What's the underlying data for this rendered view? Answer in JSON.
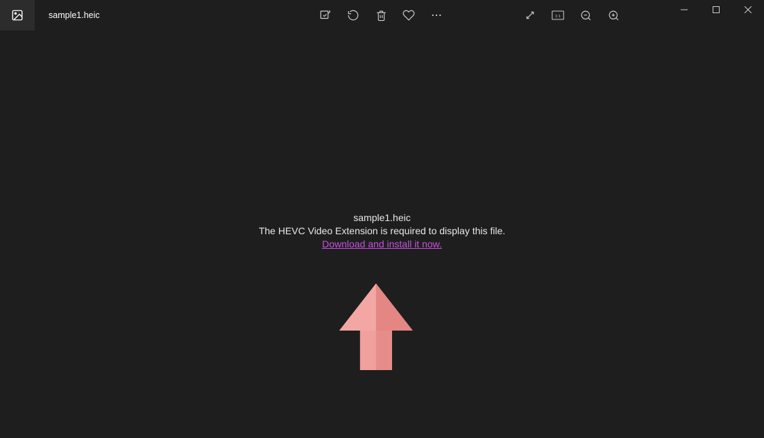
{
  "titlebar": {
    "filename": "sample1.heic"
  },
  "toolbar": {
    "center_icons": {
      "edit": "edit-image-icon",
      "rotate": "rotate-icon",
      "delete": "delete-icon",
      "favorite": "favorite-icon",
      "more": "more-icon"
    },
    "right_icons": {
      "fullscreen": "fullscreen-icon",
      "actual_size": "actual-size-icon",
      "zoom_out": "zoom-out-icon",
      "zoom_in": "zoom-in-icon"
    }
  },
  "window_controls": {
    "minimize": "minimize-icon",
    "maximize": "maximize-icon",
    "close": "close-icon"
  },
  "content": {
    "filename": "sample1.heic",
    "error_text": "The HEVC Video Extension is required to display this file.",
    "link_text": "Download and install it now."
  }
}
